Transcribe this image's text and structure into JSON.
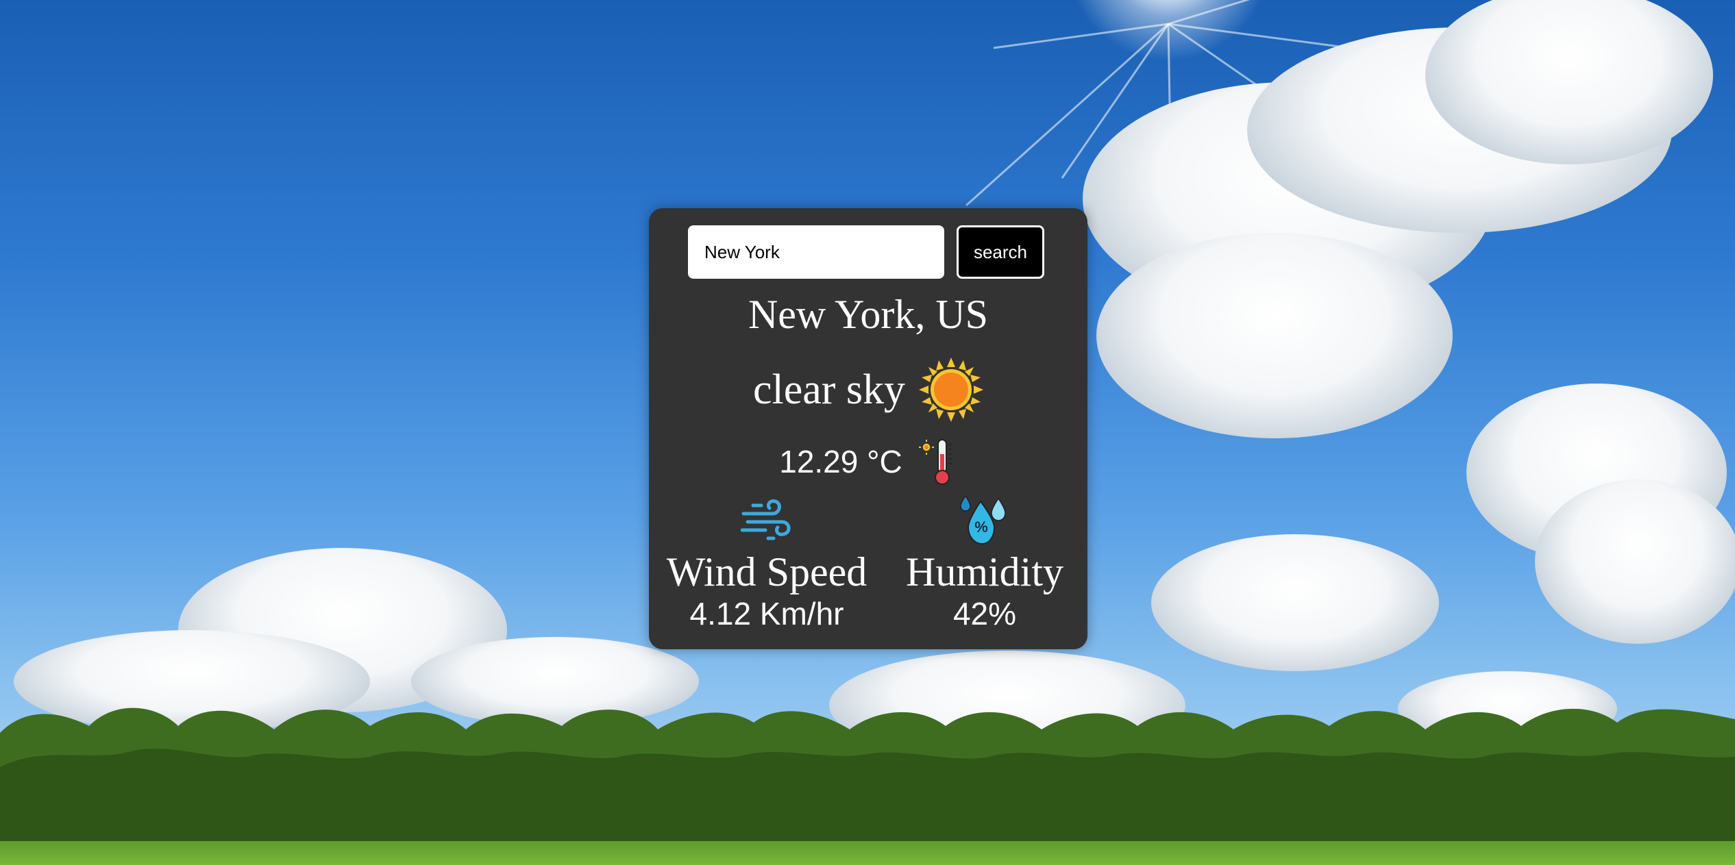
{
  "search": {
    "value": "New York",
    "button_label": "search"
  },
  "weather": {
    "location": "New York, US",
    "description": "clear sky",
    "description_icon": "sun-icon",
    "temperature": "12.29 °C",
    "temperature_icon": "thermometer-icon",
    "wind": {
      "icon": "wind-icon",
      "label": "Wind Speed",
      "value": "4.12 Km/hr"
    },
    "humidity": {
      "icon": "humidity-icon",
      "label": "Humidity",
      "value": "42%"
    }
  },
  "colors": {
    "card_background": "#333333",
    "text": "#ffffff",
    "button_background": "#000000",
    "sun_orange": "#f5841f",
    "sun_rays": "#f7c531",
    "thermometer_red": "#e2414b",
    "wind_blue": "#3fa9db",
    "water_blue": "#32b8e6"
  }
}
